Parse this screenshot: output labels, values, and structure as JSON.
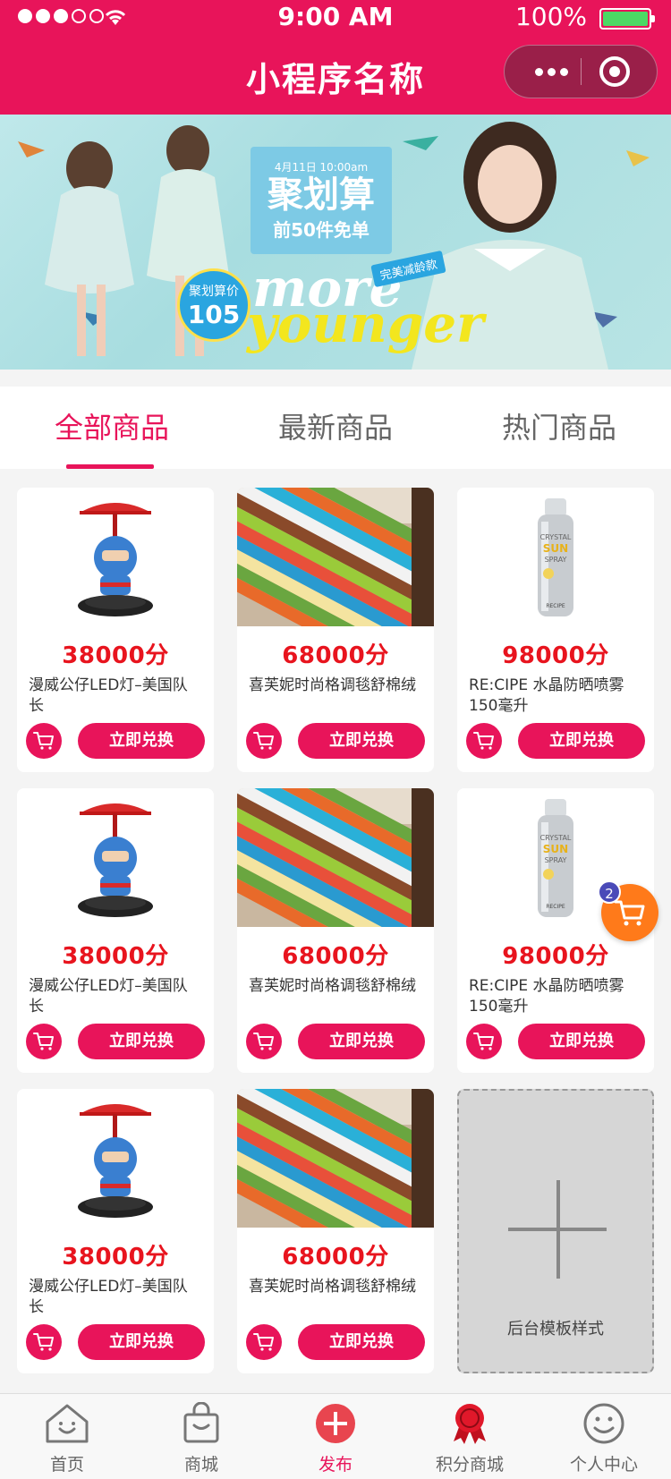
{
  "status_bar": {
    "time": "9:00 AM",
    "battery": "100%"
  },
  "header": {
    "title": "小程序名称"
  },
  "banner": {
    "date_text": "4月11日 10:00am",
    "promo_title": "聚划算",
    "promo_subtitle": "前50件免单",
    "price_label": "聚划算价",
    "price_value": "105",
    "slogan_1": "more",
    "slogan_2": "younger",
    "tag": "完美减龄款"
  },
  "tabs": [
    {
      "label": "全部商品",
      "active": true
    },
    {
      "label": "最新商品",
      "active": false
    },
    {
      "label": "热门商品",
      "active": false
    }
  ],
  "products": [
    {
      "price": "38000分",
      "name": "漫威公仔LED灯–美国队长",
      "button": "立即兑换",
      "image": "captain-lamp"
    },
    {
      "price": "68000分",
      "name": "喜芙妮时尚格调毯舒棉绒",
      "button": "立即兑换",
      "image": "striped-blanket"
    },
    {
      "price": "98000分",
      "name": "RE:CIPE 水晶防晒喷雾150毫升",
      "button": "立即兑换",
      "image": "sun-spray"
    },
    {
      "price": "38000分",
      "name": "漫威公仔LED灯–美国队长",
      "button": "立即兑换",
      "image": "captain-lamp"
    },
    {
      "price": "68000分",
      "name": "喜芙妮时尚格调毯舒棉绒",
      "button": "立即兑换",
      "image": "striped-blanket"
    },
    {
      "price": "98000分",
      "name": "RE:CIPE 水晶防晒喷雾150毫升",
      "button": "立即兑换",
      "image": "sun-spray"
    },
    {
      "price": "38000分",
      "name": "漫威公仔LED灯–美国队长",
      "button": "立即兑换",
      "image": "captain-lamp"
    },
    {
      "price": "68000分",
      "name": "喜芙妮时尚格调毯舒棉绒",
      "button": "立即兑换",
      "image": "striped-blanket"
    }
  ],
  "placeholder": {
    "label": "后台模板样式"
  },
  "floating_cart": {
    "count": "2"
  },
  "bottom_nav": [
    {
      "label": "首页",
      "icon": "home-icon"
    },
    {
      "label": "商城",
      "icon": "shopping-bag-icon"
    },
    {
      "label": "发布",
      "icon": "plus-circle-icon",
      "active": true
    },
    {
      "label": "积分商城",
      "icon": "medal-icon"
    },
    {
      "label": "个人中心",
      "icon": "smiley-icon"
    }
  ],
  "colors": {
    "primary": "#e8145a",
    "price": "#e8141e",
    "float_cart": "#ff7a1a"
  }
}
